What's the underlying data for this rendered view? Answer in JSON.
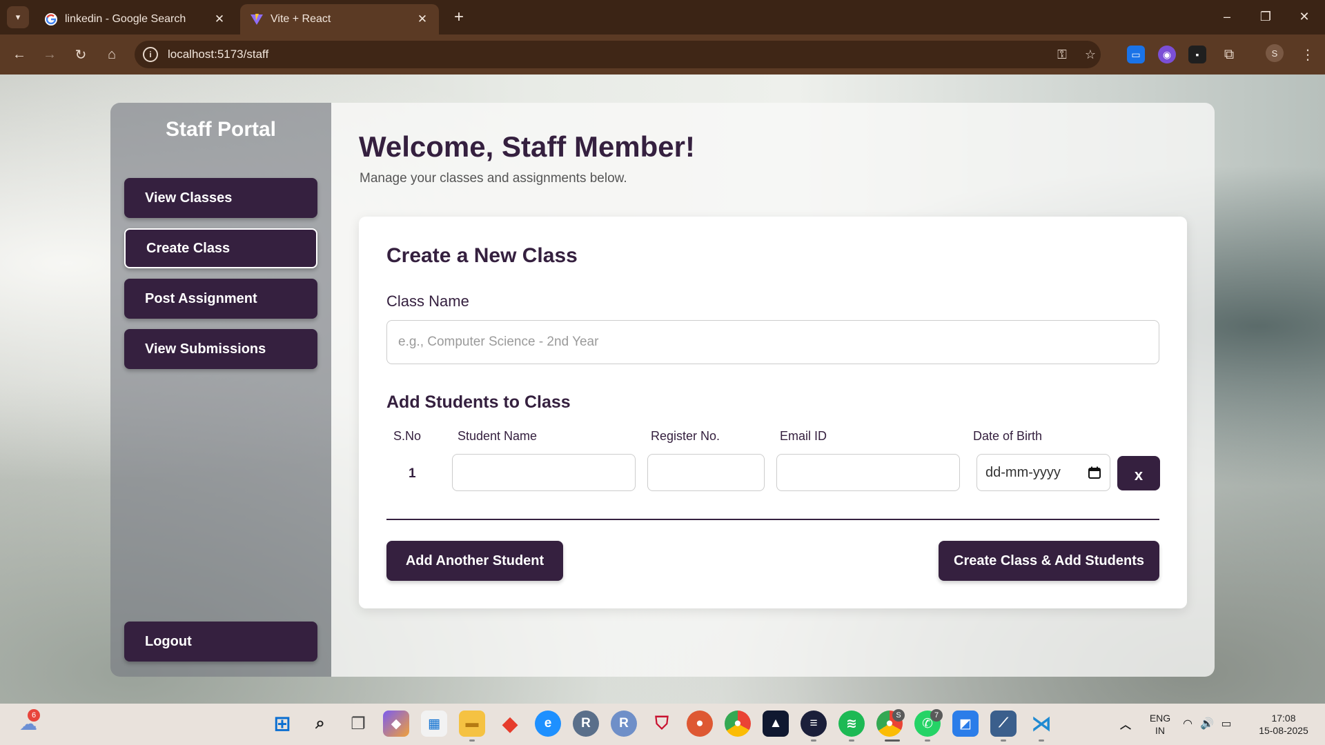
{
  "browser": {
    "tabs": [
      {
        "title": "linkedin - Google Search",
        "favicon": "google-icon",
        "active": false
      },
      {
        "title": "Vite + React",
        "favicon": "vite-icon",
        "active": true
      }
    ],
    "url": "localhost:5173/staff",
    "profile_initial": "S"
  },
  "sidebar": {
    "title": "Staff Portal",
    "items": [
      {
        "label": "View Classes"
      },
      {
        "label": "Create Class",
        "active": true
      },
      {
        "label": "Post Assignment"
      },
      {
        "label": "View Submissions"
      }
    ],
    "logout_label": "Logout"
  },
  "header": {
    "title": "Welcome, Staff Member!",
    "subtitle": "Manage your classes and assignments below."
  },
  "form": {
    "title": "Create a New Class",
    "class_name_label": "Class Name",
    "class_name_placeholder": "e.g., Computer Science - 2nd Year",
    "students_title": "Add Students to Class",
    "columns": [
      "S.No",
      "Student Name",
      "Register No.",
      "Email ID",
      "Date of Birth"
    ],
    "rows": [
      {
        "sno": "1",
        "student_name": "",
        "register_no": "",
        "email": "",
        "dob_placeholder": "dd-mm-yyyy"
      }
    ],
    "remove_label": "x",
    "add_student_label": "Add Another Student",
    "submit_label": "Create Class & Add Students"
  },
  "taskbar": {
    "weather_badge": "6",
    "whatsapp_badge": "7",
    "chrome_badge": "S",
    "language": "ENG",
    "region": "IN",
    "time": "17:08",
    "date": "15-08-2025"
  },
  "colors": {
    "accent": "#35203f",
    "browser_frame": "#3b2415",
    "browser_toolbar": "#5b3a24"
  }
}
